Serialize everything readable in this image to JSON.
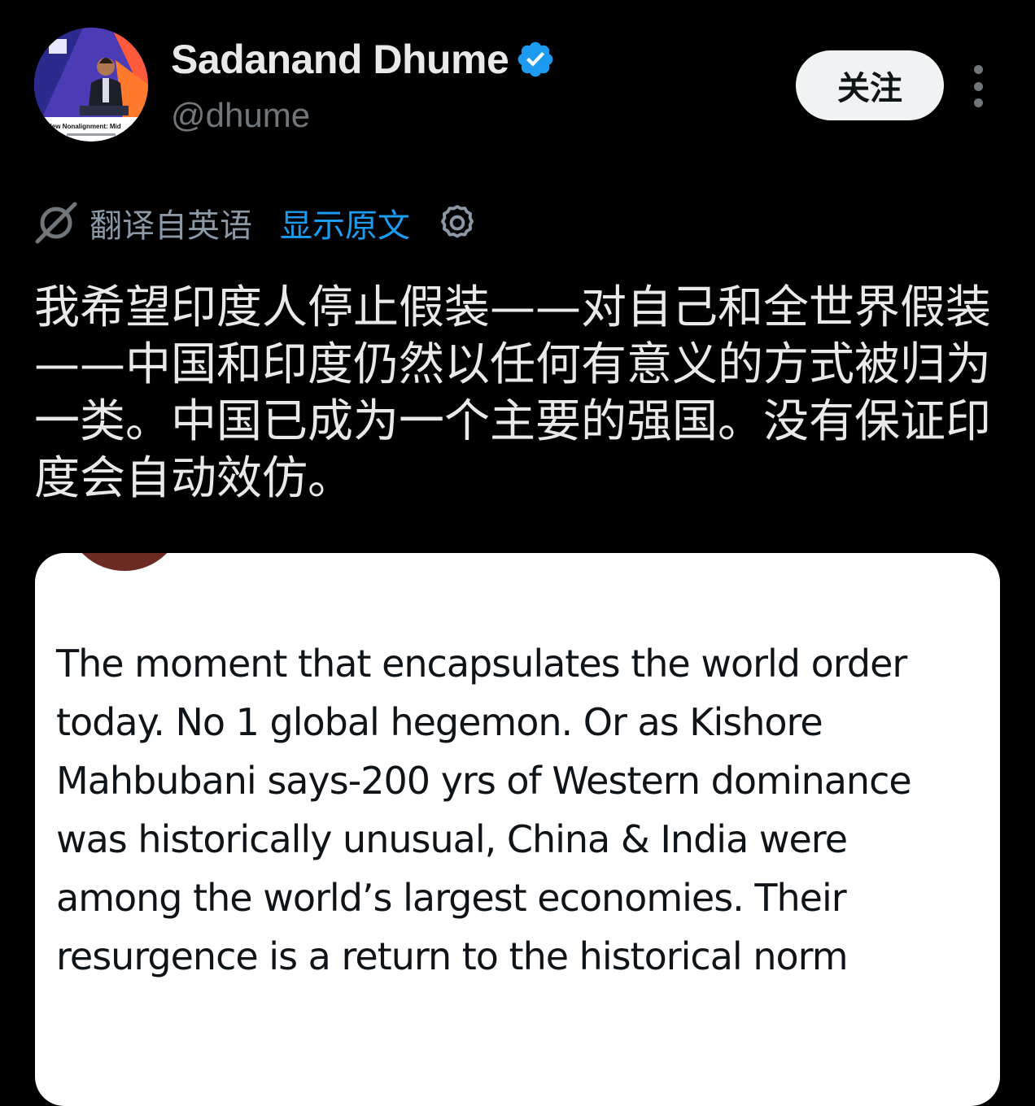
{
  "author": {
    "display_name": "Sadanand Dhume",
    "handle": "@dhume",
    "verified": true,
    "avatar_banner_text": "New Nonalignment: Mid"
  },
  "actions": {
    "follow_label": "关注",
    "more_icon": "more-vertical-icon"
  },
  "translation": {
    "icon": "translate-icon",
    "translated_from": "翻译自英语",
    "show_original": "显示原文",
    "settings_icon": "gear-icon"
  },
  "tweet": {
    "text": "我希望印度人停止假装——对自己和全世界假装——中国和印度仍然以任何有意义的方式被归为一类。中国已成为一个主要的强国。没有保证印度会自动效仿。"
  },
  "quoted_tweet": {
    "text": "The moment that encapsulates the world order today. No 1 global hegemon. Or as Kishore Mahbubani says-200 yrs of Western dominance was historically unusual, China & India were among the world’s largest economies. Their resurgence is a return to the historical norm"
  },
  "colors": {
    "background": "#000000",
    "primary_text": "#e7e9ea",
    "secondary_text": "#71767b",
    "link_blue": "#1d9bf0",
    "verified_blue": "#1d9bf0",
    "follow_button_bg": "#eff3f4",
    "quote_card_bg": "#ffffff",
    "quote_text": "#0f1419"
  }
}
